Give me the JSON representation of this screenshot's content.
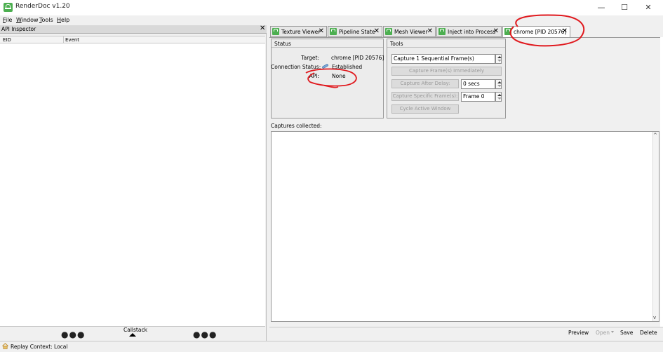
{
  "window": {
    "title": "RenderDoc v1.20",
    "minimize": "—",
    "maximize": "☐",
    "close": "✕"
  },
  "menu": [
    {
      "underline": "F",
      "rest": "ile"
    },
    {
      "underline": "W",
      "rest": "indow"
    },
    {
      "underline": "T",
      "rest": "ools"
    },
    {
      "underline": "H",
      "rest": "elp"
    }
  ],
  "api_inspector": {
    "title": "API Inspector",
    "columns": [
      "EID",
      "Event"
    ],
    "dots_left": "●●●",
    "dots_right": "●●●",
    "callstack_label": "Callstack"
  },
  "tabs": [
    {
      "label": "Texture Viewer",
      "close": "✕"
    },
    {
      "label": "Pipeline State",
      "close": "✕"
    },
    {
      "label": "Mesh Viewer",
      "close": "✕"
    },
    {
      "label": "Inject into Process",
      "close": "✕"
    },
    {
      "label": "chrome [PID 20576]",
      "close": "✕"
    }
  ],
  "status_box": {
    "title": "Status",
    "target_label": "Target:",
    "target_value": "chrome [PID 20576]",
    "connection_label": "Connection Status:",
    "connection_value": "Established",
    "api_label": "API:",
    "api_value": "None"
  },
  "tools_box": {
    "title": "Tools",
    "capture_field": "Capture 1 Sequential Frame(s)",
    "capture_immediately": "Capture Frame(s) Immediately",
    "capture_after_delay": "Capture After Delay:",
    "delay_value": "0 secs",
    "capture_specific": "Capture Specific Frame(s):",
    "frame_value": "Frame 0",
    "cycle_window": "Cycle Active Window"
  },
  "captures": {
    "label": "Captures collected:"
  },
  "bottom_buttons": {
    "preview": "Preview",
    "open": "Open",
    "save": "Save",
    "delete": "Delete"
  },
  "statusbar": {
    "text": "Replay Context: Local"
  },
  "colors": {
    "accent_green": "#4caf50",
    "annotation_red": "#e0191e"
  }
}
